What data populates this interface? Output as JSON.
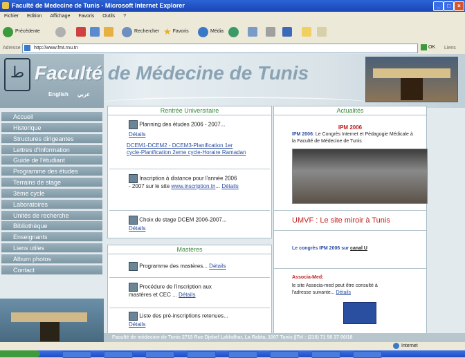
{
  "window": {
    "title": "Faculté de Medecine de Tunis - Microsoft Internet Explorer"
  },
  "menu": [
    "Fichier",
    "Edition",
    "Affichage",
    "Favoris",
    "Outils",
    "?"
  ],
  "toolbar": {
    "back": "Précédente",
    "search": "Rechercher",
    "favorites": "Favoris",
    "media": "Média"
  },
  "address": {
    "label": "Adresse",
    "url": "http://www.fmt.rnu.tn",
    "go": "OK",
    "links": "Liens"
  },
  "site": {
    "title_part1": "Faculté",
    "title_part2": " de Médecine de Tunis",
    "lang_en": "English",
    "lang_ar": "عربي"
  },
  "nav": [
    "Accueil",
    "Historique",
    "Structures dirigeantes",
    "Lettres d'Information",
    "Guide de l'étudiant",
    "Programme des études",
    "Terrains de stage",
    "3ème cycle",
    "Laboratoires",
    "Unités de recherche",
    "Bibliothèque",
    "Enseignants",
    "Liens utiles",
    "Album photos",
    "Contact"
  ],
  "rentree": {
    "title": "Rentrée Universitaire",
    "item1_text": "Planning des études 2006 - 2007...",
    "item1_link": "Détails",
    "item1_links": "DCEM1-DCEM2 - DCEM3-Planification 1er cycle-Planification 2eme cycle-Horaire Ramadan",
    "item2_text": "Inscription à distance pour l'année 2006 - 2007 sur le site",
    "item2_site": "www.inscription.tn",
    "item2_sep": "...",
    "item2_link": "Détails",
    "item3_text": "Choix de stage DCEM 2006-2007...",
    "item3_link": "Détails"
  },
  "masteres": {
    "title": "Mastères",
    "item1_text": "Programme des mastères...",
    "item1_link": "Détails",
    "item2_text": "Procédure de l'inscription aux mastères et CEC ...",
    "item2_link": "Détails",
    "item3_text": "Liste des pré-inscriptions retenues...",
    "item3_link": "Détails"
  },
  "actualites": {
    "title": "Actualités",
    "ipm_heading": "IPM 2006",
    "ipm_lead": "IPM 2006",
    "ipm_rest": ": Le Congrès Internet et Pédagogie Médicale à la Faculté de Médecine de Tunis",
    "umvf": "UMVF : Le site miroir à Tunis",
    "congres_text": "Le congrès IPM 2006 sur",
    "congres_link": "canal U",
    "assoca_title": "Associa-Med:",
    "assoca_text": "le site Associa-med peut être consulté à l'adresse suivante...",
    "assoca_link": "Détails"
  },
  "footer": "Faculté de médecine de Tunis 2715 Rue Djebel Lakhdhar, La Rabta, 1007 Tunis ||Tel : (216) 71 56 37 00/18",
  "status": {
    "zone": "Internet"
  },
  "colors": {
    "accent_green": "#3a8a3a",
    "red": "#c02020",
    "link": "#2a4ea0",
    "nav": "#8aa2ae"
  }
}
